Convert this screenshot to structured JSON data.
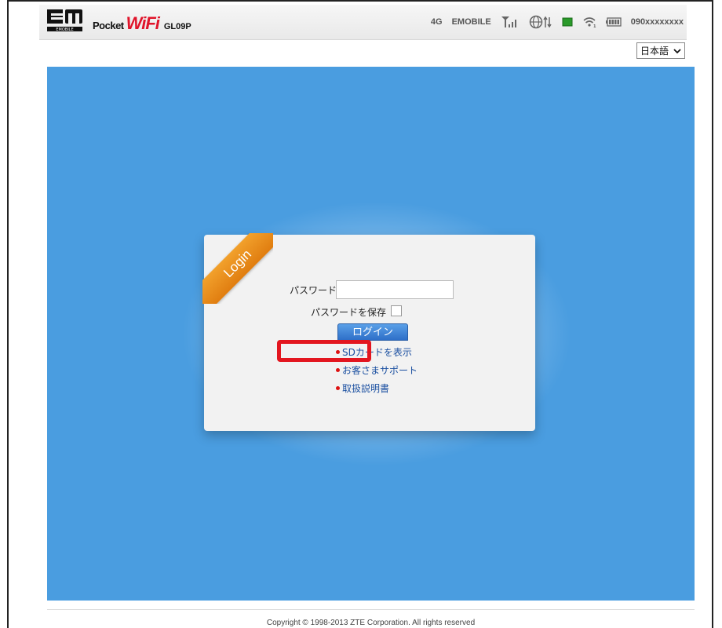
{
  "header": {
    "brand_pocket": "Pocket",
    "brand_wifi": "WiFi",
    "model": "GL09P",
    "network_type": "4G",
    "carrier": "EMOBILE",
    "phone_number": "090xxxxxxxx",
    "icons": [
      "signal-strength-icon",
      "internet-connection-icon",
      "sim-icon",
      "wifi-icon",
      "battery-icon"
    ]
  },
  "language": {
    "selected": "日本語"
  },
  "login": {
    "ribbon_label": "Login",
    "password_label": "パスワード",
    "password_value": "",
    "save_password_label": "パスワードを保存",
    "login_button": "ログイン",
    "links": [
      {
        "label": "SDカードを表示"
      },
      {
        "label": "お客さまサポート"
      },
      {
        "label": "取扱説明書"
      }
    ]
  },
  "footer": {
    "copyright": "Copyright © 1998-2013 ZTE Corporation. All rights reserved"
  },
  "colors": {
    "background": "#4a9de0",
    "accent": "#e0142a",
    "highlight": "#e3161f",
    "ribbon": "#e88a1a"
  }
}
